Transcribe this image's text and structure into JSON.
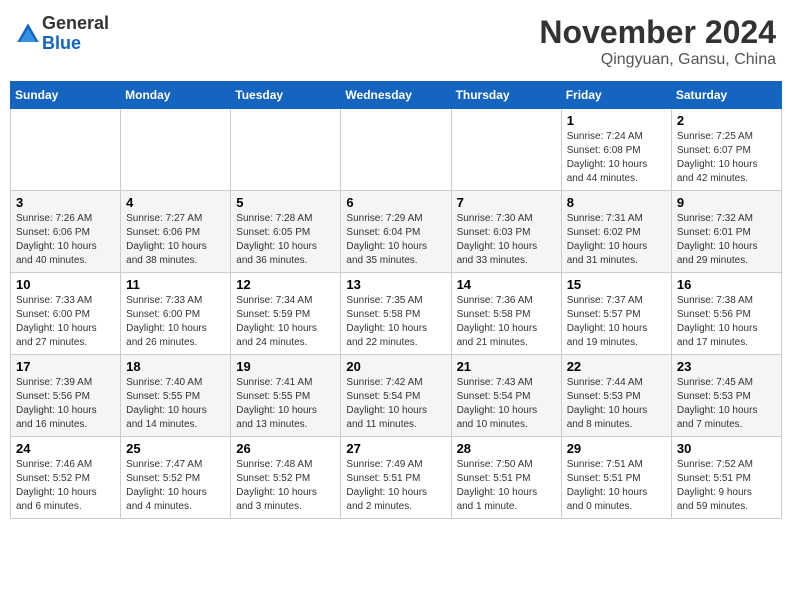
{
  "header": {
    "logo": {
      "line1": "General",
      "line2": "Blue"
    },
    "title": "November 2024",
    "location": "Qingyuan, Gansu, China"
  },
  "weekdays": [
    "Sunday",
    "Monday",
    "Tuesday",
    "Wednesday",
    "Thursday",
    "Friday",
    "Saturday"
  ],
  "weeks": [
    [
      {
        "day": "",
        "info": ""
      },
      {
        "day": "",
        "info": ""
      },
      {
        "day": "",
        "info": ""
      },
      {
        "day": "",
        "info": ""
      },
      {
        "day": "",
        "info": ""
      },
      {
        "day": "1",
        "info": "Sunrise: 7:24 AM\nSunset: 6:08 PM\nDaylight: 10 hours\nand 44 minutes."
      },
      {
        "day": "2",
        "info": "Sunrise: 7:25 AM\nSunset: 6:07 PM\nDaylight: 10 hours\nand 42 minutes."
      }
    ],
    [
      {
        "day": "3",
        "info": "Sunrise: 7:26 AM\nSunset: 6:06 PM\nDaylight: 10 hours\nand 40 minutes."
      },
      {
        "day": "4",
        "info": "Sunrise: 7:27 AM\nSunset: 6:06 PM\nDaylight: 10 hours\nand 38 minutes."
      },
      {
        "day": "5",
        "info": "Sunrise: 7:28 AM\nSunset: 6:05 PM\nDaylight: 10 hours\nand 36 minutes."
      },
      {
        "day": "6",
        "info": "Sunrise: 7:29 AM\nSunset: 6:04 PM\nDaylight: 10 hours\nand 35 minutes."
      },
      {
        "day": "7",
        "info": "Sunrise: 7:30 AM\nSunset: 6:03 PM\nDaylight: 10 hours\nand 33 minutes."
      },
      {
        "day": "8",
        "info": "Sunrise: 7:31 AM\nSunset: 6:02 PM\nDaylight: 10 hours\nand 31 minutes."
      },
      {
        "day": "9",
        "info": "Sunrise: 7:32 AM\nSunset: 6:01 PM\nDaylight: 10 hours\nand 29 minutes."
      }
    ],
    [
      {
        "day": "10",
        "info": "Sunrise: 7:33 AM\nSunset: 6:00 PM\nDaylight: 10 hours\nand 27 minutes."
      },
      {
        "day": "11",
        "info": "Sunrise: 7:33 AM\nSunset: 6:00 PM\nDaylight: 10 hours\nand 26 minutes."
      },
      {
        "day": "12",
        "info": "Sunrise: 7:34 AM\nSunset: 5:59 PM\nDaylight: 10 hours\nand 24 minutes."
      },
      {
        "day": "13",
        "info": "Sunrise: 7:35 AM\nSunset: 5:58 PM\nDaylight: 10 hours\nand 22 minutes."
      },
      {
        "day": "14",
        "info": "Sunrise: 7:36 AM\nSunset: 5:58 PM\nDaylight: 10 hours\nand 21 minutes."
      },
      {
        "day": "15",
        "info": "Sunrise: 7:37 AM\nSunset: 5:57 PM\nDaylight: 10 hours\nand 19 minutes."
      },
      {
        "day": "16",
        "info": "Sunrise: 7:38 AM\nSunset: 5:56 PM\nDaylight: 10 hours\nand 17 minutes."
      }
    ],
    [
      {
        "day": "17",
        "info": "Sunrise: 7:39 AM\nSunset: 5:56 PM\nDaylight: 10 hours\nand 16 minutes."
      },
      {
        "day": "18",
        "info": "Sunrise: 7:40 AM\nSunset: 5:55 PM\nDaylight: 10 hours\nand 14 minutes."
      },
      {
        "day": "19",
        "info": "Sunrise: 7:41 AM\nSunset: 5:55 PM\nDaylight: 10 hours\nand 13 minutes."
      },
      {
        "day": "20",
        "info": "Sunrise: 7:42 AM\nSunset: 5:54 PM\nDaylight: 10 hours\nand 11 minutes."
      },
      {
        "day": "21",
        "info": "Sunrise: 7:43 AM\nSunset: 5:54 PM\nDaylight: 10 hours\nand 10 minutes."
      },
      {
        "day": "22",
        "info": "Sunrise: 7:44 AM\nSunset: 5:53 PM\nDaylight: 10 hours\nand 8 minutes."
      },
      {
        "day": "23",
        "info": "Sunrise: 7:45 AM\nSunset: 5:53 PM\nDaylight: 10 hours\nand 7 minutes."
      }
    ],
    [
      {
        "day": "24",
        "info": "Sunrise: 7:46 AM\nSunset: 5:52 PM\nDaylight: 10 hours\nand 6 minutes."
      },
      {
        "day": "25",
        "info": "Sunrise: 7:47 AM\nSunset: 5:52 PM\nDaylight: 10 hours\nand 4 minutes."
      },
      {
        "day": "26",
        "info": "Sunrise: 7:48 AM\nSunset: 5:52 PM\nDaylight: 10 hours\nand 3 minutes."
      },
      {
        "day": "27",
        "info": "Sunrise: 7:49 AM\nSunset: 5:51 PM\nDaylight: 10 hours\nand 2 minutes."
      },
      {
        "day": "28",
        "info": "Sunrise: 7:50 AM\nSunset: 5:51 PM\nDaylight: 10 hours\nand 1 minute."
      },
      {
        "day": "29",
        "info": "Sunrise: 7:51 AM\nSunset: 5:51 PM\nDaylight: 10 hours\nand 0 minutes."
      },
      {
        "day": "30",
        "info": "Sunrise: 7:52 AM\nSunset: 5:51 PM\nDaylight: 9 hours\nand 59 minutes."
      }
    ]
  ]
}
